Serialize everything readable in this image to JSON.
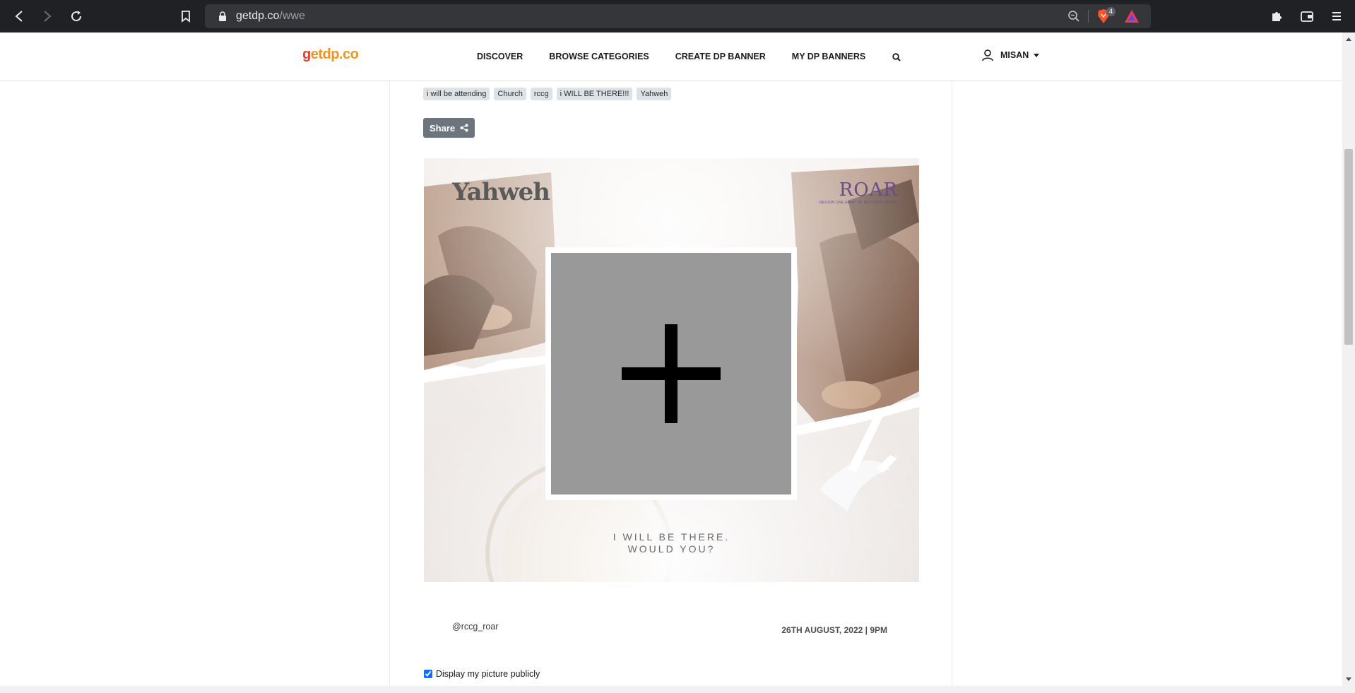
{
  "browser": {
    "url_host": "getdp.co",
    "url_path": "/wwe",
    "shields_count": "4",
    "icons": [
      "back-icon",
      "forward-icon",
      "reload-icon",
      "bookmark-icon",
      "lock-icon",
      "zoom-icon",
      "brave-shields-icon",
      "brave-rewards-icon",
      "extensions-icon",
      "wallet-icon",
      "menu-icon"
    ]
  },
  "header": {
    "logo_g": "g",
    "logo_rest": "etdp.co",
    "nav": [
      "DISCOVER",
      "BROWSE CATEGORIES",
      "CREATE DP BANNER",
      "MY DP BANNERS"
    ],
    "search_icon": "search-icon",
    "user_icon": "user-icon",
    "user_name": "MISAN"
  },
  "main": {
    "tags": [
      "i will be attending",
      "Church",
      "rccg",
      "i WILL BE THERE!!!",
      "Yahweh"
    ],
    "share_label": "Share",
    "share_icon": "share-icon",
    "banner": {
      "title": "Yahweh",
      "brand": "ROAR",
      "brand_sub": "REGION ONE ARMY OF RECONCILIATION",
      "tagline_line1": "I WILL BE THERE.",
      "tagline_line2": "WOULD YOU?",
      "add_photo_icon": "plus-icon"
    },
    "handle": "@rccg_roar",
    "event_date": "26TH AUGUST, 2022  |  9PM",
    "display_public_label": "Display my picture publicly",
    "display_public_checked": true
  },
  "colors": {
    "chrome_bg": "#202124",
    "logo_red": "#e63b2e",
    "logo_orange": "#f0941e",
    "tag_bg": "#dde2e7",
    "share_bg": "#6c757d",
    "photo_slot": "#999999"
  }
}
